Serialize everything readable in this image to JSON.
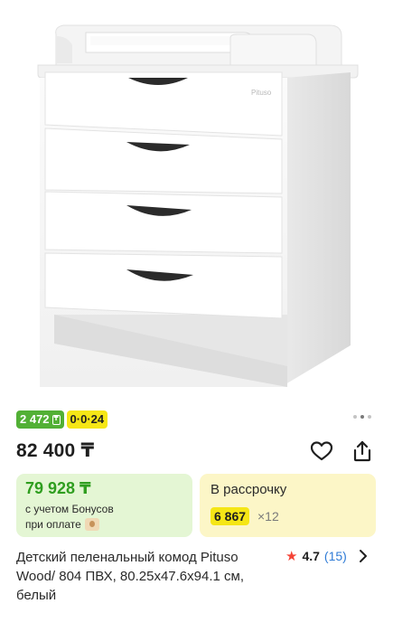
{
  "product": {
    "brand_mark": "Pituso",
    "title": "Детский пеленальный комод Pituso Wood/ 804 ПВХ, 80.25x47.6x94.1 см, белый",
    "price": "82 400 ₸",
    "badges": [
      {
        "text": "2 472",
        "color": "#52b035"
      },
      {
        "text": "0·0·24",
        "color": "#f5e616"
      }
    ],
    "gallery": {
      "total": 3,
      "active": 2
    }
  },
  "bonus_card": {
    "price": "79 928 ₸",
    "line1": "с учетом Бонусов",
    "line2": "при оплате"
  },
  "installment_card": {
    "title": "В рассрочку",
    "amount": "6 867",
    "multiplier": "×12"
  },
  "rating": {
    "value": "4.7",
    "count": "(15)"
  },
  "icons": {
    "favorite": "heart-icon",
    "share": "share-icon",
    "rating": "star-icon",
    "more": "chevron-right-icon"
  },
  "colors": {
    "accent_green": "#52b035",
    "bonus_text": "#2f9e1f",
    "accent_yellow": "#f5e616",
    "rating_star": "#f44336",
    "link_blue": "#2f7bd6"
  }
}
